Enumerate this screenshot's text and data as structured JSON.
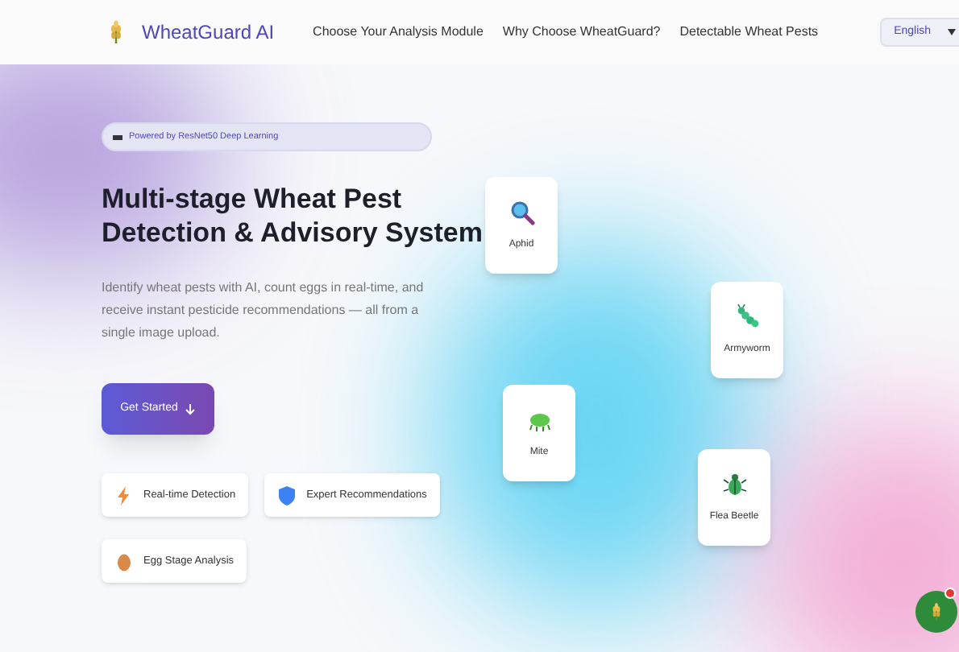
{
  "nav": {
    "brand": "WheatGuard AI",
    "links": [
      "Choose Your Analysis Module",
      "Why Choose WheatGuard?",
      "Detectable Wheat Pests"
    ],
    "language": "English"
  },
  "hero": {
    "badge": "Powered by ResNet50 Deep Learning",
    "title": "Multi-stage Wheat Pest Detection & Advisory System",
    "subtitle": "Identify wheat pests with AI, count eggs in real-time, and receive instant pesticide recommendations — all from a single image upload.",
    "cta": "Get Started",
    "features": [
      {
        "kind": "bolt",
        "label": "Real-time Detection"
      },
      {
        "kind": "shield",
        "label": "Expert Recommendations"
      },
      {
        "kind": "egg",
        "label": "Egg Stage Analysis"
      }
    ]
  },
  "pests": [
    {
      "kind": "magnifier",
      "name": "Aphid"
    },
    {
      "kind": "caterpillar",
      "name": "Armyworm"
    },
    {
      "kind": "mite",
      "name": "Mite"
    },
    {
      "kind": "beetle",
      "name": "Flea Beetle"
    }
  ],
  "chat": {
    "notification": true
  }
}
